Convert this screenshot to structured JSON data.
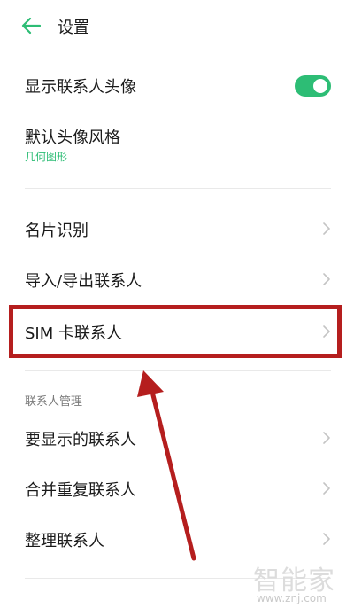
{
  "colors": {
    "accent": "#2dbd75",
    "annotation": "#b51e1e",
    "chevron": "#c4c4c4"
  },
  "header": {
    "title": "设置",
    "back_icon": "back-arrow-icon"
  },
  "display_settings": {
    "show_avatar": {
      "label": "显示联系人头像",
      "toggle_on": true
    },
    "avatar_style": {
      "label": "默认头像风格",
      "value": "几何图形"
    }
  },
  "contact_tools": [
    {
      "label": "名片识别"
    },
    {
      "label": "导入/导出联系人"
    },
    {
      "label": "SIM 卡联系人"
    }
  ],
  "management": {
    "section_label": "联系人管理",
    "items": [
      {
        "label": "要显示的联系人"
      },
      {
        "label": "合并重复联系人"
      },
      {
        "label": "整理联系人"
      }
    ]
  },
  "watermark": {
    "text": "智能家",
    "url": "www.znj.com"
  }
}
